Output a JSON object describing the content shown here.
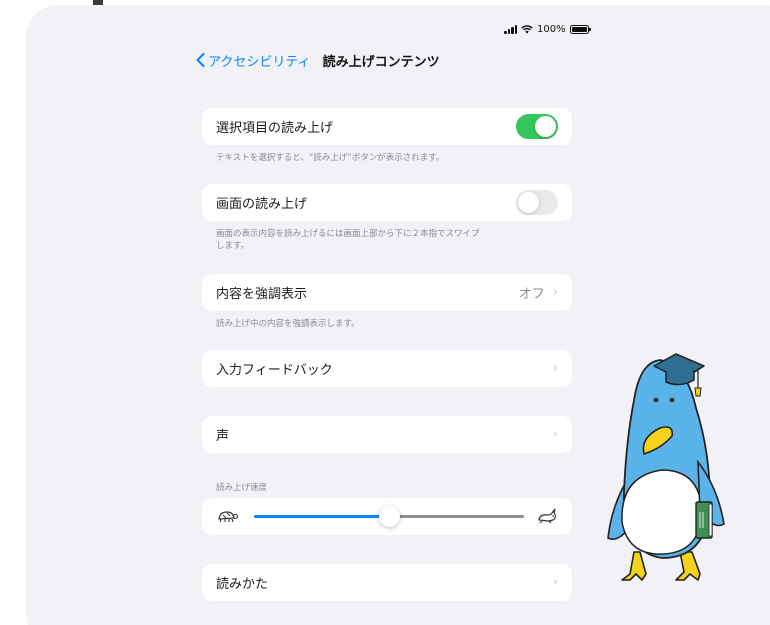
{
  "status_bar": {
    "battery_percent": "100%",
    "signal": "signal-bars-icon",
    "wifi": "wifi-icon",
    "battery_icon": "battery-icon"
  },
  "nav": {
    "back_label": "アクセシビリティ",
    "title": "読み上げコンテンツ"
  },
  "rows": {
    "speak_selection": {
      "label": "選択項目の読み上げ",
      "on": true,
      "footer": "テキストを選択すると、“読み上げ”ボタンが表示されます。"
    },
    "speak_screen": {
      "label": "画面の読み上げ",
      "on": false,
      "footer_line1": "画面の表示内容を読み上げるには画面上部から下に２本指でスワイプ",
      "footer_line2": "します。"
    },
    "highlight": {
      "label": "内容を強調表示",
      "value": "オフ",
      "footer": "読み上げ中の内容を強調表示します。"
    },
    "typing_feedback": {
      "label": "入力フィードバック"
    },
    "voices": {
      "label": "声"
    },
    "speaking_rate": {
      "header": "読み上げ速度",
      "value_fraction": 0.5
    },
    "pronunciations": {
      "label": "読みかた"
    }
  },
  "colors": {
    "accent": "#0a84ff",
    "toggle_on": "#34c759",
    "background": "#f2f2f6"
  },
  "decoration": {
    "mascot": "penguin-graduate-illustration"
  }
}
